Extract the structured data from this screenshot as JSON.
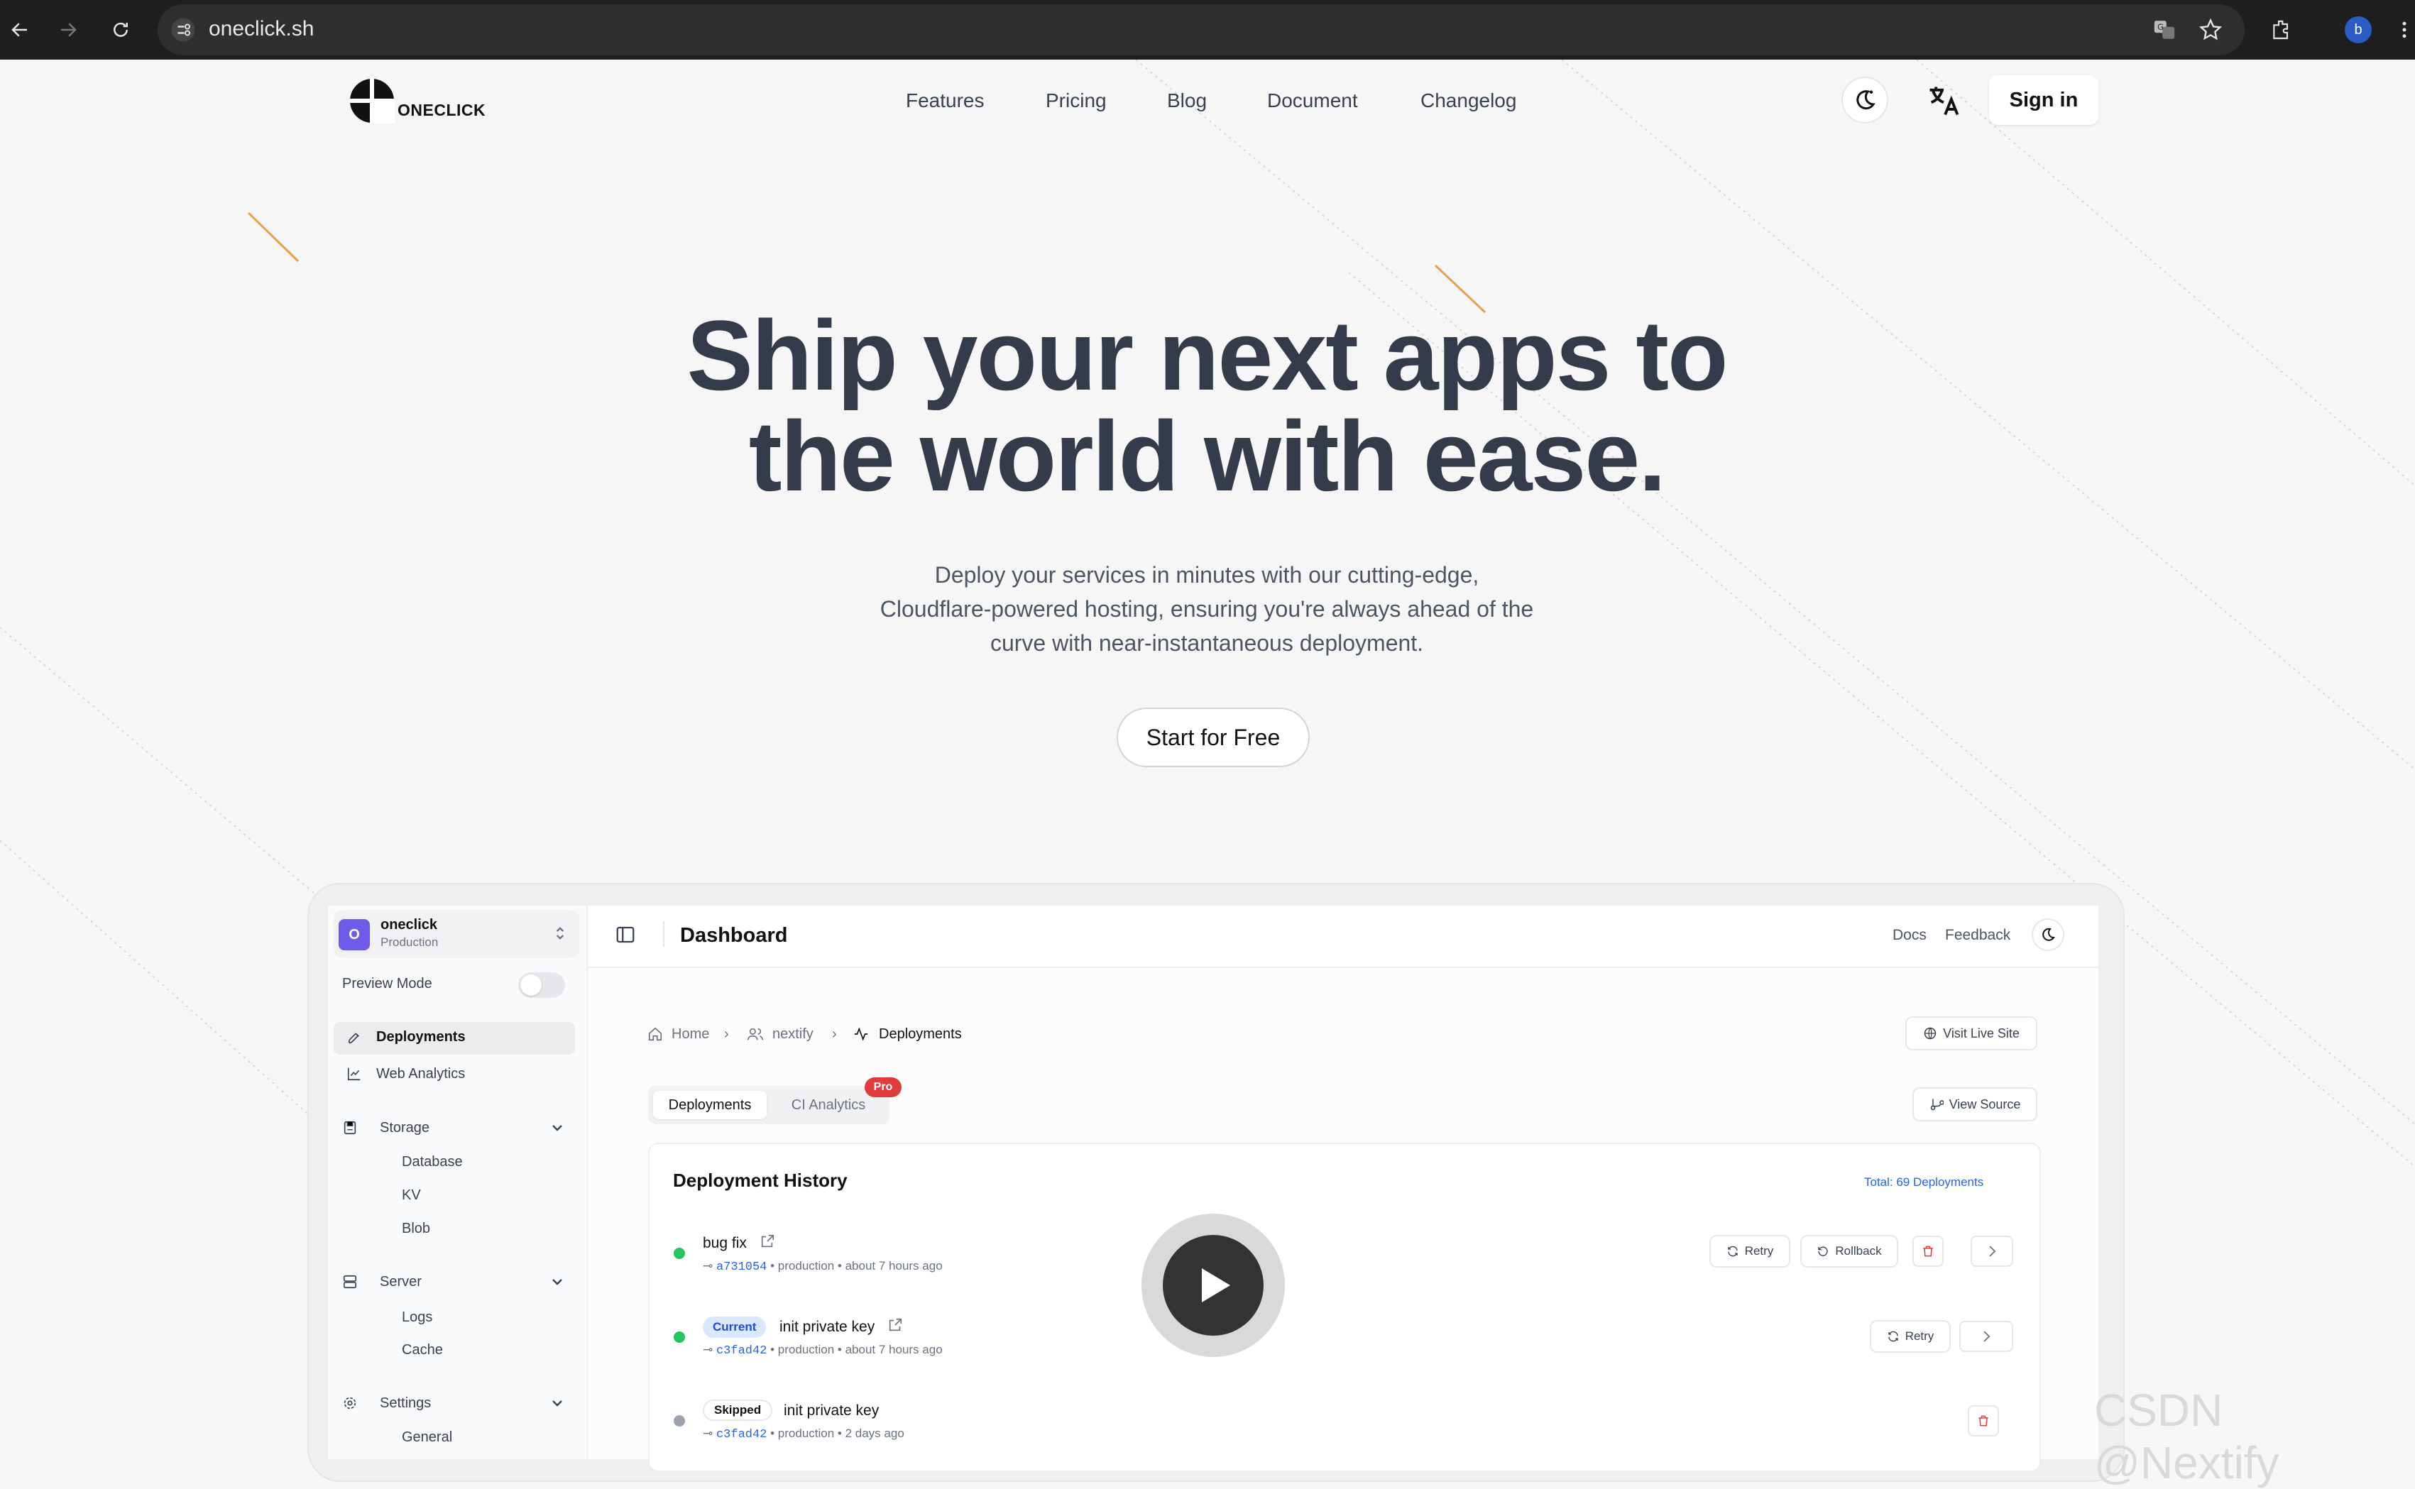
{
  "browser": {
    "url": "oneclick.sh",
    "profile_initial": "b"
  },
  "header": {
    "logo_text": "ONECLICK",
    "nav": [
      "Features",
      "Pricing",
      "Blog",
      "Document",
      "Changelog"
    ],
    "sign_in": "Sign in"
  },
  "hero": {
    "title_line1": "Ship your next apps to",
    "title_line2": "the world with ease.",
    "subtitle_line1": "Deploy your services in minutes with our cutting-edge,",
    "subtitle_line2": "Cloudflare-powered hosting, ensuring you're always ahead of the",
    "subtitle_line3": "curve with near-instantaneous deployment.",
    "cta": "Start for Free"
  },
  "dashboard": {
    "workspace": {
      "name": "oneclick",
      "env": "Production",
      "avatar": "O"
    },
    "preview_mode": "Preview Mode",
    "sidebar": {
      "deployments": "Deployments",
      "web_analytics": "Web Analytics",
      "storage": "Storage",
      "storage_items": [
        "Database",
        "KV",
        "Blob"
      ],
      "server": "Server",
      "server_items": [
        "Logs",
        "Cache"
      ],
      "settings": "Settings",
      "settings_items": [
        "General"
      ]
    },
    "title": "Dashboard",
    "docs": "Docs",
    "feedback": "Feedback",
    "breadcrumb": [
      "Home",
      "nextify",
      "Deployments"
    ],
    "visit_live_site": "Visit Live Site",
    "view_source": "View Source",
    "tabs": [
      "Deployments",
      "CI Analytics"
    ],
    "pro_badge": "Pro",
    "history_title": "Deployment History",
    "total": "Total: 69 Deployments",
    "rows": [
      {
        "title": "bug fix",
        "hash": "a731054",
        "env": "production",
        "time": "about 7 hours ago",
        "badge": "",
        "status_color": "#22c55e"
      },
      {
        "title": "init private key",
        "hash": "c3fad42",
        "env": "production",
        "time": "about 7 hours ago",
        "badge": "Current",
        "status_color": "#22c55e"
      },
      {
        "title": "init private key",
        "hash": "c3fad42",
        "env": "production",
        "time": "2 days ago",
        "badge": "Skipped",
        "status_color": "#9ca3af"
      }
    ],
    "retry": "Retry",
    "rollback": "Rollback"
  },
  "watermark": "CSDN @Nextify",
  "colors": {
    "accent": "#2563eb",
    "danger": "#e03c3c",
    "avatar": "#6d5ce8"
  }
}
